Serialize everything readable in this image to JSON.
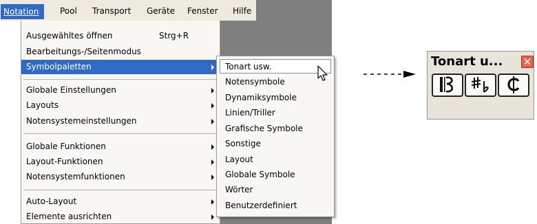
{
  "menubar": {
    "items": [
      {
        "label": "Notation",
        "active": true
      },
      {
        "label": "Pool"
      },
      {
        "label": "Transport"
      },
      {
        "label": "Geräte"
      },
      {
        "label": "Fenster"
      },
      {
        "label": "Hilfe"
      }
    ]
  },
  "menu": {
    "items": [
      {
        "label": "Ausgewähltes öffnen",
        "shortcut": "Strg+R"
      },
      {
        "label": "Bearbeitungs-/Seitenmodus"
      },
      {
        "label": "Symbolpaletten",
        "submenu": true,
        "highlighted": true
      },
      {
        "label": "Globale Einstellungen",
        "submenu": true
      },
      {
        "label": "Layouts",
        "submenu": true
      },
      {
        "label": "Notensystemeinstellungen",
        "submenu": true
      },
      {
        "label": "Globale Funktionen",
        "submenu": true
      },
      {
        "label": "Layout-Funktionen",
        "submenu": true
      },
      {
        "label": "Notensystemfunktionen",
        "submenu": true
      },
      {
        "label": "Auto-Layout",
        "submenu": true
      },
      {
        "label": "Elemente ausrichten",
        "submenu": true
      }
    ]
  },
  "submenu": {
    "items": [
      {
        "label": "Tonart usw.",
        "highlighted": true
      },
      {
        "label": "Notensymbole"
      },
      {
        "label": "Dynamiksymbole"
      },
      {
        "label": "Linien/Triller"
      },
      {
        "label": "Grafische Symbole"
      },
      {
        "label": "Sonstige"
      },
      {
        "label": "Layout"
      },
      {
        "label": "Globale Symbole"
      },
      {
        "label": "Wörter"
      },
      {
        "label": "Benutzerdefiniert"
      }
    ]
  },
  "palette": {
    "title": "Tonart u...",
    "close_icon": "close-icon",
    "buttons": [
      {
        "icon": "clef-icon"
      },
      {
        "icon": "sharp-flat-icon"
      },
      {
        "icon": "common-time-icon"
      }
    ]
  },
  "colors": {
    "menubar_bg": "#eeeae0",
    "menu_bg": "#f8f7f3",
    "highlight": "#316ac5",
    "app_background": "#7f7f7f",
    "close_button": "#e8624a"
  }
}
